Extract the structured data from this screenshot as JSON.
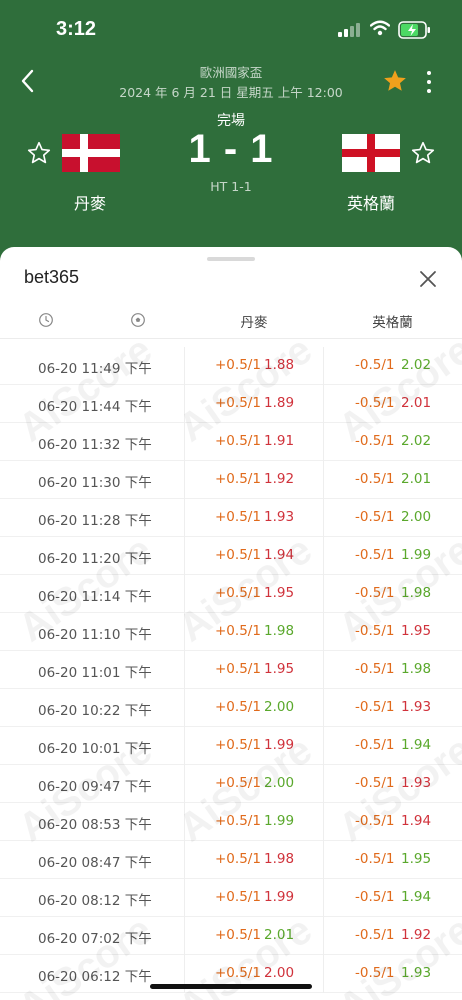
{
  "status_bar": {
    "time": "3:12"
  },
  "match": {
    "competition": "歐洲國家盃",
    "datetime": "2024 年 6 月 21 日 星期五 上午 12:00",
    "status": "完場",
    "score": "1 - 1",
    "halftime": "HT 1-1",
    "home_team": "丹麥",
    "away_team": "英格蘭"
  },
  "sheet": {
    "title": "bet365",
    "columns": {
      "home": "丹麥",
      "away": "英格蘭"
    },
    "watermark_text": "AiScore"
  },
  "colors": {
    "header_green": "#2f6e3b",
    "handicap_orange": "#e06a1b",
    "odds_up_red": "#d0323b",
    "odds_down_green": "#5aa82c",
    "fav_star": "#f0a01c"
  },
  "rows": [
    {
      "time": "06-20 11:49 下午",
      "home_line": "+0.5/1",
      "home_odds": "1.88",
      "home_dir": "up",
      "away_line": "-0.5/1",
      "away_odds": "2.02",
      "away_dir": "down"
    },
    {
      "time": "06-20 11:44 下午",
      "home_line": "+0.5/1",
      "home_odds": "1.89",
      "home_dir": "up",
      "away_line": "-0.5/1",
      "away_odds": "2.01",
      "away_dir": "up"
    },
    {
      "time": "06-20 11:32 下午",
      "home_line": "+0.5/1",
      "home_odds": "1.91",
      "home_dir": "up",
      "away_line": "-0.5/1",
      "away_odds": "2.02",
      "away_dir": "down"
    },
    {
      "time": "06-20 11:30 下午",
      "home_line": "+0.5/1",
      "home_odds": "1.92",
      "home_dir": "up",
      "away_line": "-0.5/1",
      "away_odds": "2.01",
      "away_dir": "down"
    },
    {
      "time": "06-20 11:28 下午",
      "home_line": "+0.5/1",
      "home_odds": "1.93",
      "home_dir": "up",
      "away_line": "-0.5/1",
      "away_odds": "2.00",
      "away_dir": "down"
    },
    {
      "time": "06-20 11:20 下午",
      "home_line": "+0.5/1",
      "home_odds": "1.94",
      "home_dir": "up",
      "away_line": "-0.5/1",
      "away_odds": "1.99",
      "away_dir": "down"
    },
    {
      "time": "06-20 11:14 下午",
      "home_line": "+0.5/1",
      "home_odds": "1.95",
      "home_dir": "up",
      "away_line": "-0.5/1",
      "away_odds": "1.98",
      "away_dir": "down"
    },
    {
      "time": "06-20 11:10 下午",
      "home_line": "+0.5/1",
      "home_odds": "1.98",
      "home_dir": "down",
      "away_line": "-0.5/1",
      "away_odds": "1.95",
      "away_dir": "up"
    },
    {
      "time": "06-20 11:01 下午",
      "home_line": "+0.5/1",
      "home_odds": "1.95",
      "home_dir": "up",
      "away_line": "-0.5/1",
      "away_odds": "1.98",
      "away_dir": "down"
    },
    {
      "time": "06-20 10:22 下午",
      "home_line": "+0.5/1",
      "home_odds": "2.00",
      "home_dir": "down",
      "away_line": "-0.5/1",
      "away_odds": "1.93",
      "away_dir": "up"
    },
    {
      "time": "06-20 10:01 下午",
      "home_line": "+0.5/1",
      "home_odds": "1.99",
      "home_dir": "up",
      "away_line": "-0.5/1",
      "away_odds": "1.94",
      "away_dir": "down"
    },
    {
      "time": "06-20 09:47 下午",
      "home_line": "+0.5/1",
      "home_odds": "2.00",
      "home_dir": "down",
      "away_line": "-0.5/1",
      "away_odds": "1.93",
      "away_dir": "up"
    },
    {
      "time": "06-20 08:53 下午",
      "home_line": "+0.5/1",
      "home_odds": "1.99",
      "home_dir": "down",
      "away_line": "-0.5/1",
      "away_odds": "1.94",
      "away_dir": "up"
    },
    {
      "time": "06-20 08:47 下午",
      "home_line": "+0.5/1",
      "home_odds": "1.98",
      "home_dir": "up",
      "away_line": "-0.5/1",
      "away_odds": "1.95",
      "away_dir": "down"
    },
    {
      "time": "06-20 08:12 下午",
      "home_line": "+0.5/1",
      "home_odds": "1.99",
      "home_dir": "up",
      "away_line": "-0.5/1",
      "away_odds": "1.94",
      "away_dir": "down"
    },
    {
      "time": "06-20 07:02 下午",
      "home_line": "+0.5/1",
      "home_odds": "2.01",
      "home_dir": "down",
      "away_line": "-0.5/1",
      "away_odds": "1.92",
      "away_dir": "up"
    },
    {
      "time": "06-20 06:12 下午",
      "home_line": "+0.5/1",
      "home_odds": "2.00",
      "home_dir": "up",
      "away_line": "-0.5/1",
      "away_odds": "1.93",
      "away_dir": "down"
    }
  ]
}
